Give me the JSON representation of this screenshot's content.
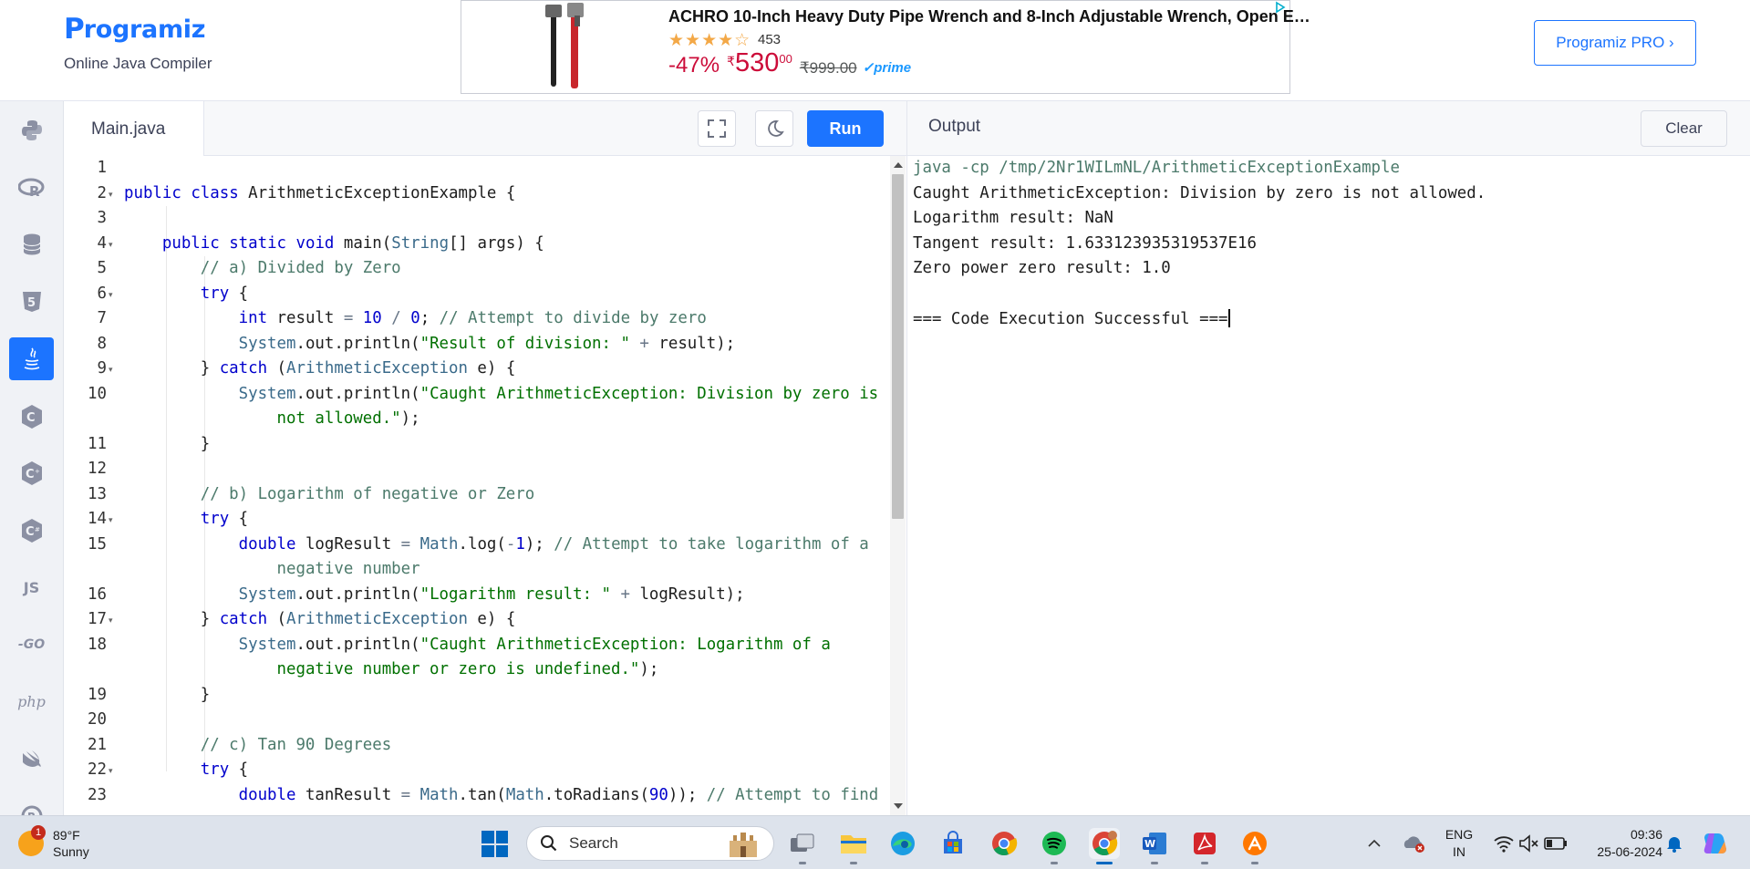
{
  "header": {
    "logo_mark": "P",
    "logo_text": "rogramiz",
    "subtitle": "Online Java Compiler",
    "pro_button": "Programiz PRO ›"
  },
  "ad": {
    "title": "ACHRO 10-Inch Heavy Duty Pipe Wrench and 8-Inch Adjustable Wrench, Open E…",
    "stars": "★★★★☆",
    "rating_count": "453",
    "discount": "-47%",
    "currency": "₹",
    "price": "530",
    "price_fraction": "00",
    "mrp": "₹999.00",
    "prime": "✓prime"
  },
  "sidebar": {
    "items": [
      {
        "name": "python",
        "icon": "python-icon"
      },
      {
        "name": "r",
        "icon": "r-icon"
      },
      {
        "name": "sql",
        "icon": "database-icon"
      },
      {
        "name": "html",
        "icon": "html5-icon"
      },
      {
        "name": "java",
        "icon": "java-icon",
        "active": true
      },
      {
        "name": "c",
        "icon": "c-icon"
      },
      {
        "name": "cpp",
        "icon": "cpp-icon"
      },
      {
        "name": "csharp",
        "icon": "csharp-icon"
      },
      {
        "name": "js",
        "label": "JS"
      },
      {
        "name": "go",
        "label": "-GO"
      },
      {
        "name": "php",
        "label": "php"
      },
      {
        "name": "swift",
        "icon": "swift-icon"
      },
      {
        "name": "rust",
        "icon": "rust-icon"
      }
    ]
  },
  "editor": {
    "tab_label": "Main.java",
    "run_label": "Run",
    "lines": [
      {
        "num": "1",
        "fold": false,
        "html": ""
      },
      {
        "num": "2",
        "fold": true,
        "html": "<span class=\"k\">public</span> <span class=\"k\">class</span> ArithmeticExceptionExample {"
      },
      {
        "num": "3",
        "fold": false,
        "html": ""
      },
      {
        "num": "4",
        "fold": true,
        "html": "    <span class=\"k\">public</span> <span class=\"k\">static</span> <span class=\"k\">void</span> main(<span class=\"sb\">String</span>[] args) {"
      },
      {
        "num": "5",
        "fold": false,
        "html": "        <span class=\"c\">// a) Divided by Zero</span>"
      },
      {
        "num": "6",
        "fold": true,
        "html": "        <span class=\"k\">try</span> {"
      },
      {
        "num": "7",
        "fold": false,
        "html": "            <span class=\"t\">int</span> result <span class=\"o\">=</span> <span class=\"n\">10</span> <span class=\"o\">/</span> <span class=\"n\">0</span>; <span class=\"c\">// Attempt to divide by zero</span>"
      },
      {
        "num": "8",
        "fold": false,
        "html": "            <span class=\"sb\">System</span>.out.println(<span class=\"s\">\"Result of division: \"</span> <span class=\"o\">+</span> result);"
      },
      {
        "num": "9",
        "fold": true,
        "html": "        } <span class=\"k\">catch</span> (<span class=\"sb\">ArithmeticException</span> e) {"
      },
      {
        "num": "10",
        "fold": false,
        "html": "            <span class=\"sb\">System</span>.out.println(<span class=\"s\">\"Caught ArithmeticException: Division by zero is</span>"
      },
      {
        "num": "",
        "fold": false,
        "html": "                <span class=\"s\">not allowed.\"</span>);"
      },
      {
        "num": "11",
        "fold": false,
        "html": "        }"
      },
      {
        "num": "12",
        "fold": false,
        "html": ""
      },
      {
        "num": "13",
        "fold": false,
        "html": "        <span class=\"c\">// b) Logarithm of negative or Zero</span>"
      },
      {
        "num": "14",
        "fold": true,
        "html": "        <span class=\"k\">try</span> {"
      },
      {
        "num": "15",
        "fold": false,
        "html": "            <span class=\"t\">double</span> logResult <span class=\"o\">=</span> <span class=\"sb\">Math</span>.log(<span class=\"o\">-</span><span class=\"n\">1</span>); <span class=\"c\">// Attempt to take logarithm of a</span>"
      },
      {
        "num": "",
        "fold": false,
        "html": "                <span class=\"c\">negative number</span>"
      },
      {
        "num": "16",
        "fold": false,
        "html": "            <span class=\"sb\">System</span>.out.println(<span class=\"s\">\"Logarithm result: \"</span> <span class=\"o\">+</span> logResult);"
      },
      {
        "num": "17",
        "fold": true,
        "html": "        } <span class=\"k\">catch</span> (<span class=\"sb\">ArithmeticException</span> e) {"
      },
      {
        "num": "18",
        "fold": false,
        "html": "            <span class=\"sb\">System</span>.out.println(<span class=\"s\">\"Caught ArithmeticException: Logarithm of a</span>"
      },
      {
        "num": "",
        "fold": false,
        "html": "                <span class=\"s\">negative number or zero is undefined.\"</span>);"
      },
      {
        "num": "19",
        "fold": false,
        "html": "        }"
      },
      {
        "num": "20",
        "fold": false,
        "html": ""
      },
      {
        "num": "21",
        "fold": false,
        "html": "        <span class=\"c\">// c) Tan 90 Degrees</span>"
      },
      {
        "num": "22",
        "fold": true,
        "html": "        <span class=\"k\">try</span> {"
      },
      {
        "num": "23",
        "fold": false,
        "html": "            <span class=\"t\">double</span> tanResult <span class=\"o\">=</span> <span class=\"sb\">Math</span>.tan(<span class=\"sb\">Math</span>.toRadians(<span class=\"n\">90</span>)); <span class=\"c\">// Attempt to find</span>"
      }
    ]
  },
  "output": {
    "title": "Output",
    "clear_label": "Clear",
    "lines": [
      {
        "text": "java -cp /tmp/2Nr1WILmNL/ArithmeticExceptionExample",
        "cmd": true
      },
      {
        "text": "Caught ArithmeticException: Division by zero is not allowed."
      },
      {
        "text": "Logarithm result: NaN"
      },
      {
        "text": "Tangent result: 1.633123935319537E16"
      },
      {
        "text": "Zero power zero result: 1.0"
      },
      {
        "text": ""
      },
      {
        "text": "=== Code Execution Successful ===",
        "cursor": true
      }
    ]
  },
  "taskbar": {
    "weather_badge": "1",
    "temperature": "89°F",
    "condition": "Sunny",
    "search_placeholder": "Search",
    "apps": [
      "task-view",
      "file-explorer",
      "edge",
      "microsoft-store",
      "chrome",
      "spotify",
      "chrome-profile",
      "word",
      "acrobat",
      "avast"
    ],
    "lang_line1": "ENG",
    "lang_line2": "IN",
    "time": "09:36",
    "date": "25-06-2024"
  }
}
